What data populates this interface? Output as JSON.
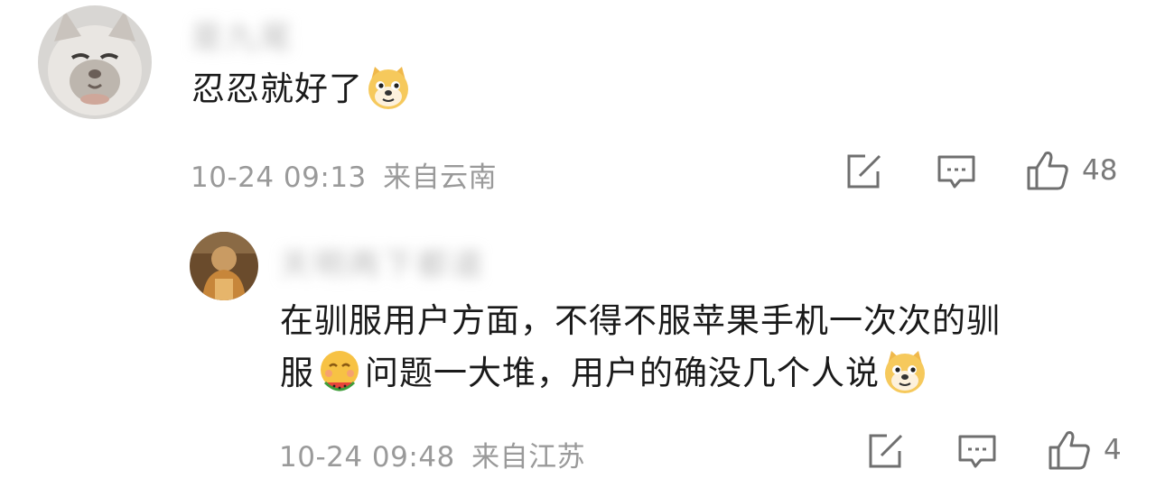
{
  "comments": [
    {
      "username": "是九尾",
      "text": "忍忍就好了",
      "trailing_emoji": "doge-emoji",
      "date": "10-24 09:13",
      "location": "来自云南",
      "likes": "48"
    },
    {
      "username": "天明两下都道",
      "text_line1": "在驯服用户方面，不得不服苹果手机一次次的驯",
      "text_line2_a": "服",
      "inline_emoji": "eating-watermelon-emoji",
      "text_line2_b": "问题一大堆，用户的确没几个人说",
      "trailing_emoji": "doge-emoji",
      "date": "10-24 09:48",
      "location": "来自江苏",
      "likes": "4"
    }
  ],
  "icons": {
    "repost": "repost-icon",
    "comment": "comment-icon",
    "like": "thumbs-up-icon"
  },
  "colors": {
    "meta_text": "#9a9a9a",
    "body_text": "#1a1a1a",
    "icon_stroke": "#6f6f6f"
  }
}
